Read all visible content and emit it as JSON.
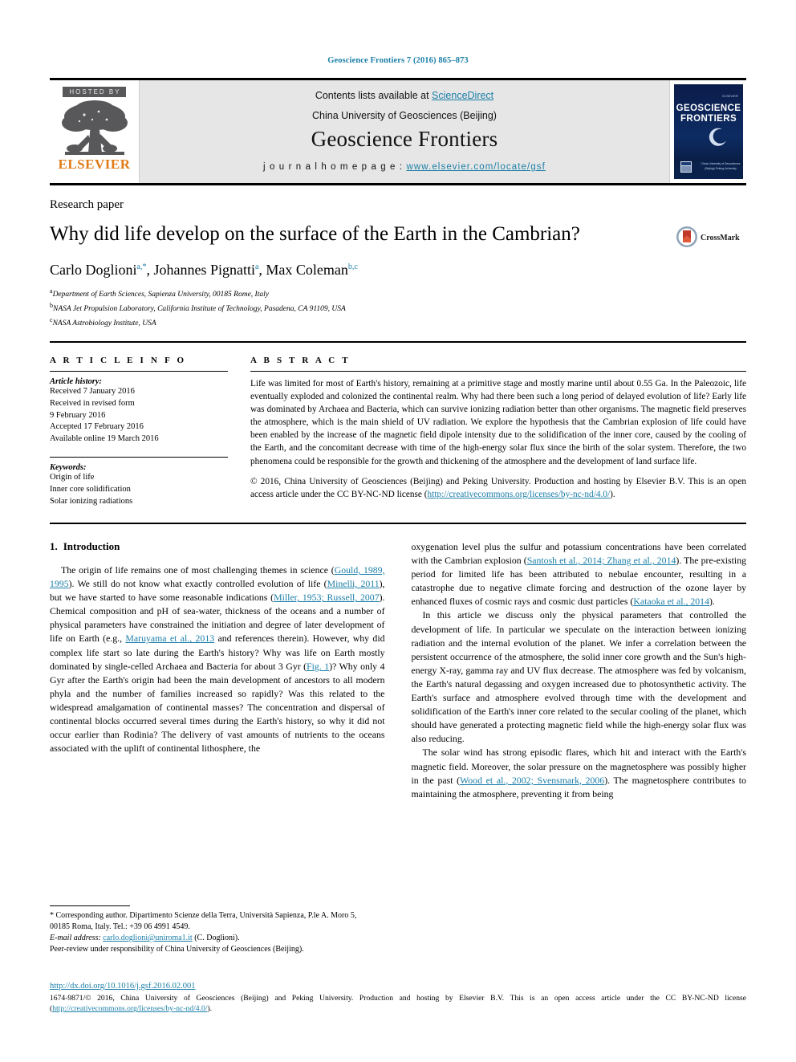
{
  "running_head": "Geoscience Frontiers 7 (2016) 865–873",
  "masthead": {
    "hosted_by": "HOSTED BY",
    "publisher_logo_text": "ELSEVIER",
    "contents_prefix": "Contents lists available at ",
    "contents_link": "ScienceDirect",
    "institution": "China University of Geosciences (Beijing)",
    "journal_name": "Geoscience Frontiers",
    "homepage_label": "j o u r n a l   h o m e p a g e :  ",
    "homepage_url": "www.elsevier.com/locate/gsf",
    "cover_title_line1": "GEOSCIENCE",
    "cover_title_line2": "FRONTIERS"
  },
  "article": {
    "doctype": "Research paper",
    "title": "Why did life develop on the surface of the Earth in the Cambrian?",
    "crossmark_label": "CrossMark",
    "authors_plain": "Carlo Doglioni a,*, Johannes Pignatti a, Max Coleman b,c",
    "authors": [
      {
        "name": "Carlo Doglioni",
        "marks": "a,*"
      },
      {
        "name": "Johannes Pignatti",
        "marks": "a"
      },
      {
        "name": "Max Coleman",
        "marks": "b,c"
      }
    ],
    "affiliations": [
      {
        "mark": "a",
        "text": "Department of Earth Sciences, Sapienza University, 00185 Rome, Italy"
      },
      {
        "mark": "b",
        "text": "NASA Jet Propulsion Laboratory, California Institute of Technology, Pasadena, CA 91109, USA"
      },
      {
        "mark": "c",
        "text": "NASA Astrobiology Institute, USA"
      }
    ]
  },
  "article_info": {
    "heading": "A R T I C L E   I N F O",
    "history_label": "Article history:",
    "history": [
      "Received 7 January 2016",
      "Received in revised form",
      "9 February 2016",
      "Accepted 17 February 2016",
      "Available online 19 March 2016"
    ],
    "keywords_label": "Keywords:",
    "keywords": [
      "Origin of life",
      "Inner core solidification",
      "Solar ionizing radiations"
    ]
  },
  "abstract": {
    "heading": "A B S T R A C T",
    "body": "Life was limited for most of Earth's history, remaining at a primitive stage and mostly marine until about 0.55 Ga. In the Paleozoic, life eventually exploded and colonized the continental realm. Why had there been such a long period of delayed evolution of life? Early life was dominated by Archaea and Bacteria, which can survive ionizing radiation better than other organisms. The magnetic field preserves the atmosphere, which is the main shield of UV radiation. We explore the hypothesis that the Cambrian explosion of life could have been enabled by the increase of the magnetic field dipole intensity due to the solidification of the inner core, caused by the cooling of the Earth, and the concomitant decrease with time of the high-energy solar flux since the birth of the solar system. Therefore, the two phenomena could be responsible for the growth and thickening of the atmosphere and the development of land surface life.",
    "copyright_text": "© 2016, China University of Geosciences (Beijing) and Peking University. Production and hosting by Elsevier B.V. This is an open access article under the CC BY-NC-ND license (",
    "copyright_link": "http://creativecommons.org/licenses/by-nc-nd/4.0/",
    "copyright_tail": ")."
  },
  "sections": {
    "intro_number": "1.",
    "intro_title": "Introduction"
  },
  "left_column": {
    "para1_parts": [
      {
        "t": "The origin of life remains one of most challenging themes in science (",
        "link": false
      },
      {
        "t": "Gould, 1989, 1995",
        "link": true
      },
      {
        "t": "). We still do not know what exactly controlled evolution of life (",
        "link": false
      },
      {
        "t": "Minelli, 2011",
        "link": true
      },
      {
        "t": "), but we have started to have some reasonable indications (",
        "link": false
      },
      {
        "t": "Miller, 1953; Russell, 2007",
        "link": true
      },
      {
        "t": "). Chemical composition and pH of sea-water, thickness of the oceans and a number of physical parameters have constrained the initiation and degree of later development of life on Earth (e.g., ",
        "link": false
      },
      {
        "t": "Maruyama et al., 2013",
        "link": true
      },
      {
        "t": " and references therein). However, why did complex life start so late during the Earth's history? Why was life on Earth mostly dominated by single-celled Archaea and Bacteria for about 3 Gyr (",
        "link": false
      },
      {
        "t": "Fig. 1",
        "link": true
      },
      {
        "t": ")? Why only 4 Gyr after the Earth's origin had been the main development of ancestors to all modern phyla and the number of families increased so rapidly? Was this related to the widespread amalgamation of continental masses? The concentration and dispersal of continental blocks occurred several times during the Earth's history, so why it did not occur earlier than Rodinia? The delivery of vast amounts of nutrients to the oceans associated with the uplift of continental lithosphere, the",
        "link": false
      }
    ]
  },
  "right_column": {
    "para1_parts": [
      {
        "t": "oxygenation level plus the sulfur and potassium concentrations have been correlated with the Cambrian explosion (",
        "link": false
      },
      {
        "t": "Santosh et al., 2014; Zhang et al., 2014",
        "link": true
      },
      {
        "t": "). The pre-existing period for limited life has been attributed to nebulae encounter, resulting in a catastrophe due to negative climate forcing and destruction of the ozone layer by enhanced fluxes of cosmic rays and cosmic dust particles (",
        "link": false
      },
      {
        "t": "Kataoka et al., 2014",
        "link": true
      },
      {
        "t": ").",
        "link": false
      }
    ],
    "para2_parts": [
      {
        "t": "In this article we discuss only the physical parameters that controlled the development of life. In particular we speculate on the interaction between ionizing radiation and the internal evolution of the planet. We infer a correlation between the persistent occurrence of the atmosphere, the solid inner core growth and the Sun's high-energy X-ray, gamma ray and UV flux decrease. The atmosphere was fed by volcanism, the Earth's natural degassing and oxygen increased due to photosynthetic activity. The Earth's surface and atmosphere evolved through time with the development and solidification of the Earth's inner core related to the secular cooling of the planet, which should have generated a protecting magnetic field while the high-energy solar flux was also reducing.",
        "link": false
      }
    ],
    "para3_parts": [
      {
        "t": "The solar wind has strong episodic flares, which hit and interact with the Earth's magnetic field. Moreover, the solar pressure on the magnetosphere was possibly higher in the past (",
        "link": false
      },
      {
        "t": "Wood et al., 2002; Svensmark, 2006",
        "link": true
      },
      {
        "t": "). The magnetosphere contributes to maintaining the atmosphere, preventing it from being",
        "link": false
      }
    ]
  },
  "footnotes": {
    "corresponding": "* Corresponding author. Dipartimento Scienze della Terra, Università Sapienza, P.le A. Moro 5, 00185 Roma, Italy. Tel.: +39 06 4991 4549.",
    "email_label": "E-mail address:",
    "email": "carlo.doglioni@uniroma1.it",
    "email_tail": "(C. Doglioni).",
    "peer_review": "Peer-review under responsibility of China University of Geosciences (Beijing)."
  },
  "bottom": {
    "doi": "http://dx.doi.org/10.1016/j.gsf.2016.02.001",
    "copyright_pre": "1674-9871/© 2016, China University of Geosciences (Beijing) and Peking University. Production and hosting by Elsevier B.V. This is an open access article under the CC BY-NC-ND license (",
    "copyright_link": "http://creativecommons.org/licenses/by-nc-nd/4.0/",
    "copyright_post": ")."
  },
  "colors": {
    "link": "#1b7fa8",
    "elsevier_orange": "#e07b18",
    "hosted_bg": "#58585a",
    "masthead_bg": "#e6e6e6"
  }
}
